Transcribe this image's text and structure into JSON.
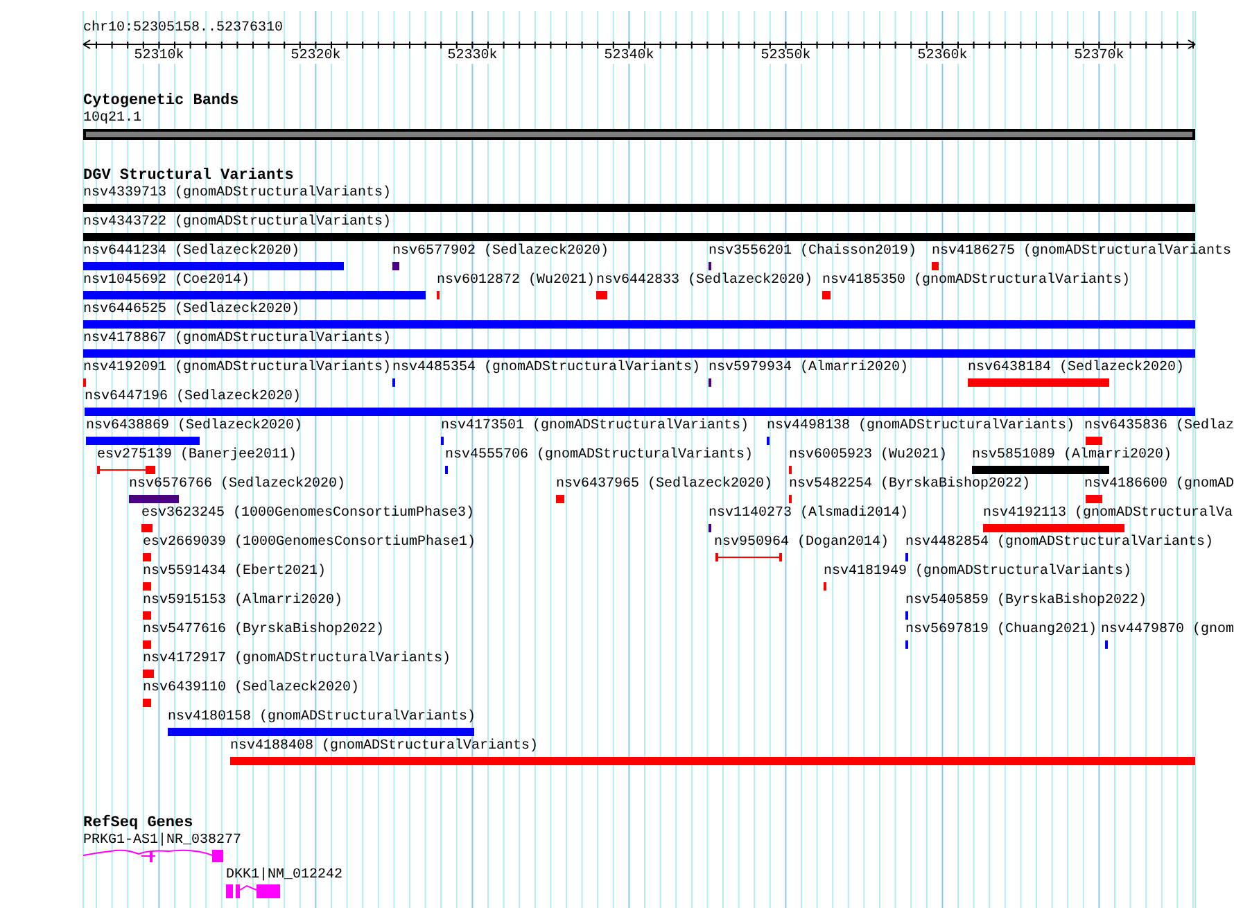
{
  "region": "chr10:52305158..52376310",
  "ruler": {
    "ticks": [
      "52310k",
      "52320k",
      "52330k",
      "52340k",
      "52350k",
      "52360k",
      "52370k"
    ]
  },
  "tracks": [
    {
      "title": "Cytogenetic Bands",
      "kind": "bands",
      "features": [
        {
          "label": "10q21.1",
          "color": "#808080"
        }
      ]
    },
    {
      "title": "DGV Structural Variants",
      "kind": "variants",
      "rows": [
        [
          {
            "label": "nsv4339713 (gnomADStructuralVariants)",
            "color": "#000000",
            "kind": "block"
          }
        ],
        [
          {
            "label": "nsv4343722 (gnomADStructuralVariants)",
            "color": "#000000",
            "kind": "block"
          }
        ],
        [
          {
            "label": "nsv6441234 (Sedlazeck2020)",
            "color": "#0000ff",
            "kind": "block"
          },
          {
            "label": "nsv6577902 (Sedlazeck2020)",
            "color": "#4b0082",
            "kind": "block"
          },
          {
            "label": "nsv3556201 (Chaisson2019)",
            "color": "#4b0082",
            "kind": "block"
          },
          {
            "label": "nsv4186275 (gnomADStructuralVariants",
            "color": "#ff0000",
            "kind": "block"
          }
        ],
        [
          {
            "label": "nsv1045692 (Coe2014)",
            "color": "#0000ff",
            "kind": "block"
          },
          {
            "label": "nsv6012872 (Wu2021)",
            "color": "#ff0000",
            "kind": "block"
          },
          {
            "label": "nsv6442833 (Sedlazeck2020)",
            "color": "#ff0000",
            "kind": "block"
          },
          {
            "label": "nsv4185350 (gnomADStructuralVariants)",
            "color": "#ff0000",
            "kind": "block"
          }
        ],
        [
          {
            "label": "nsv6446525 (Sedlazeck2020)",
            "color": "#0000ff",
            "kind": "block"
          }
        ],
        [
          {
            "label": "nsv4178867 (gnomADStructuralVariants)",
            "color": "#0000ff",
            "kind": "block"
          }
        ],
        [
          {
            "label": "nsv4192091 (gnomADStructuralVariants)",
            "color": "#ff0000",
            "kind": "block"
          },
          {
            "label": "nsv4485354 (gnomADStructuralVariants)",
            "color": "#0000ff",
            "kind": "block"
          },
          {
            "label": "nsv5979934 (Almarri2020)",
            "color": "#4b0082",
            "kind": "block"
          },
          {
            "label": "nsv6438184 (Sedlazeck2020)",
            "color": "#ff0000",
            "kind": "block"
          }
        ],
        [
          {
            "label": "nsv6447196 (Sedlazeck2020)",
            "color": "#0000ff",
            "kind": "block"
          }
        ],
        [
          {
            "label": "nsv6438869 (Sedlazeck2020)",
            "color": "#0000ff",
            "kind": "block"
          },
          {
            "label": "nsv4173501 (gnomADStructuralVariants)",
            "color": "#0000ff",
            "kind": "block"
          },
          {
            "label": "nsv4498138 (gnomADStructuralVariants)",
            "color": "#0000ff",
            "kind": "block"
          },
          {
            "label": "nsv6435836 (Sedlaz",
            "color": "#ff0000",
            "kind": "block"
          }
        ],
        [
          {
            "label": "esv275139 (Banerjee2011)",
            "color": "#ff0000",
            "kind": "interval"
          },
          {
            "label": "nsv4555706 (gnomADStructuralVariants)",
            "color": "#0000ff",
            "kind": "block"
          },
          {
            "label": "nsv6005923 (Wu2021)",
            "color": "#ff0000",
            "kind": "block"
          },
          {
            "label": "nsv5851089 (Almarri2020)",
            "color": "#000000",
            "kind": "block"
          }
        ],
        [
          {
            "label": "nsv6576766 (Sedlazeck2020)",
            "color": "#4b0082",
            "kind": "block"
          },
          {
            "label": "nsv6437965 (Sedlazeck2020)",
            "color": "#ff0000",
            "kind": "block"
          },
          {
            "label": "nsv5482254 (ByrskaBishop2022)",
            "color": "#ff0000",
            "kind": "block"
          },
          {
            "label": "nsv4186600 (gnomAD",
            "color": "#ff0000",
            "kind": "block"
          }
        ],
        [
          {
            "label": "esv3623245 (1000GenomesConsortiumPhase3)",
            "color": "#ff0000",
            "kind": "block"
          },
          {
            "label": "nsv1140273 (Alsmadi2014)",
            "color": "#4b0082",
            "kind": "block"
          },
          {
            "label": "nsv4192113 (gnomADStructuralVa",
            "color": "#ff0000",
            "kind": "block"
          }
        ],
        [
          {
            "label": "esv2669039 (1000GenomesConsortiumPhase1)",
            "color": "#ff0000",
            "kind": "block"
          },
          {
            "label": "nsv950964 (Dogan2014)",
            "color": "#ff0000",
            "kind": "interval"
          },
          {
            "label": "nsv4482854 (gnomADStructuralVariants)",
            "color": "#0000ff",
            "kind": "block"
          }
        ],
        [
          {
            "label": "nsv5591434 (Ebert2021)",
            "color": "#ff0000",
            "kind": "block"
          },
          {
            "label": "nsv4181949 (gnomADStructuralVariants)",
            "color": "#ff0000",
            "kind": "block"
          }
        ],
        [
          {
            "label": "nsv5915153 (Almarri2020)",
            "color": "#ff0000",
            "kind": "block"
          },
          {
            "label": "nsv5405859 (ByrskaBishop2022)",
            "color": "#0000ff",
            "kind": "block"
          }
        ],
        [
          {
            "label": "nsv5477616 (ByrskaBishop2022)",
            "color": "#ff0000",
            "kind": "block"
          },
          {
            "label": "nsv5697819 (Chuang2021)",
            "color": "#0000ff",
            "kind": "block"
          },
          {
            "label": "nsv4479870 (gnom",
            "color": "#0000ff",
            "kind": "block"
          }
        ],
        [
          {
            "label": "nsv4172917 (gnomADStructuralVariants)",
            "color": "#ff0000",
            "kind": "block"
          }
        ],
        [
          {
            "label": "nsv6439110 (Sedlazeck2020)",
            "color": "#ff0000",
            "kind": "block"
          }
        ],
        [
          {
            "label": "nsv4180158 (gnomADStructuralVariants)",
            "color": "#0000ff",
            "kind": "block"
          }
        ],
        [
          {
            "label": "nsv4188408 (gnomADStructuralVariants)",
            "color": "#ff0000",
            "kind": "block"
          }
        ]
      ]
    },
    {
      "title": "RefSeq Genes",
      "kind": "genes",
      "features": [
        {
          "label": "PRKG1-AS1|NR_038277",
          "color": "#ff00ff"
        },
        {
          "label": "DKK1|NM_012242",
          "color": "#ff00ff"
        }
      ]
    }
  ]
}
